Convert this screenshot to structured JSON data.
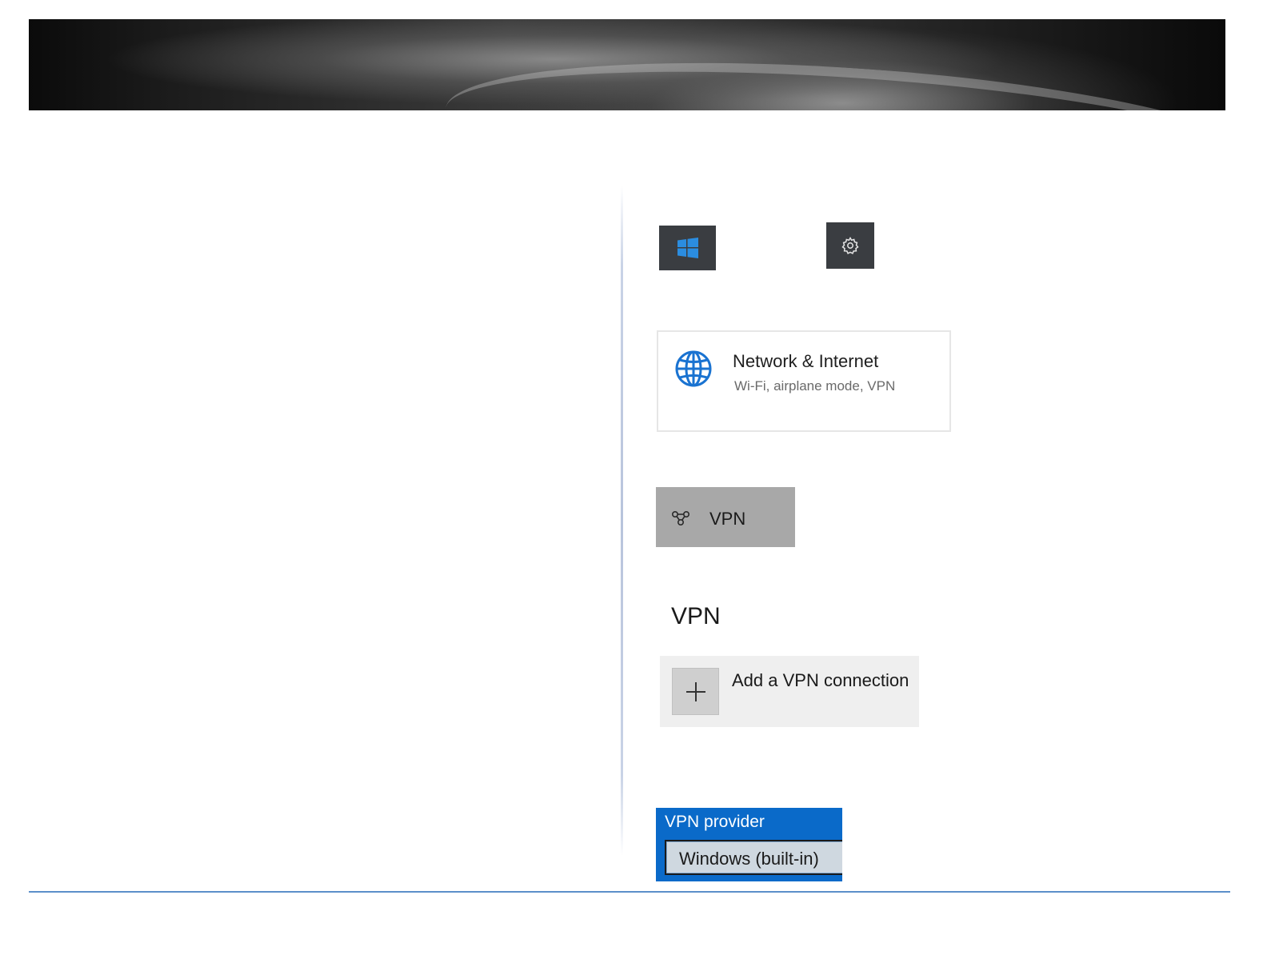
{
  "icons": {
    "start": "windows-logo-icon",
    "settings": "gear-icon",
    "network": "globe-icon",
    "vpn": "vpn-link-icon",
    "add": "plus-icon"
  },
  "colors": {
    "tile_bg": "#3a3d41",
    "accent_blue": "#0a6ac9",
    "windows_logo": "#2b8de0",
    "globe_icon": "#1a73d1",
    "vpn_nav_bg": "#a8a8a8",
    "footer_rule": "#5b8fc9"
  },
  "network_tile": {
    "title": "Network & Internet",
    "subtitle": "Wi-Fi, airplane mode, VPN"
  },
  "vpn_nav": {
    "label": "VPN"
  },
  "vpn_page": {
    "heading": "VPN",
    "add_label": "Add a VPN connection"
  },
  "vpn_provider": {
    "label": "VPN provider",
    "selected": "Windows (built-in)"
  }
}
